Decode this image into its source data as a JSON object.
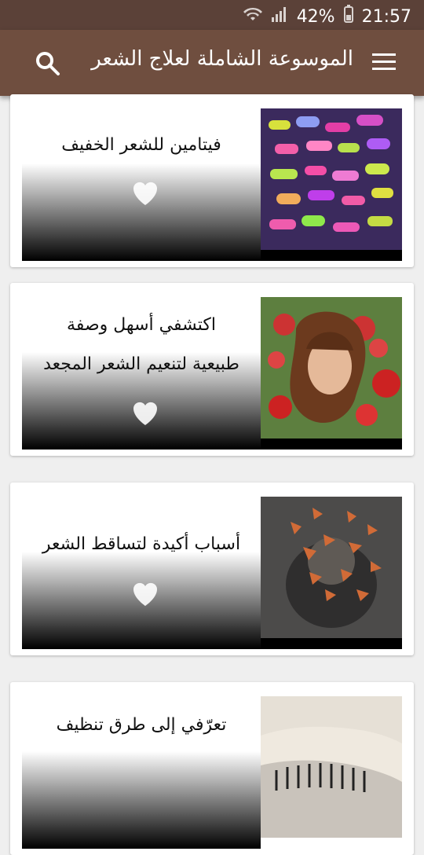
{
  "status": {
    "battery": "42%",
    "time": "21:57"
  },
  "appbar": {
    "title": "الموسوعة الشاملة لعلاج الشعر"
  },
  "cards": [
    {
      "title": "فيتامين للشعر الخفيف"
    },
    {
      "title_lines": [
        "اكتشفي أسهل وصفة",
        "طبيعية لتنعيم الشعر المجعد"
      ]
    },
    {
      "title": "أسباب أكيدة لتساقط الشعر"
    },
    {
      "title": "تعرّفي إلى طرق تنظيف"
    }
  ]
}
